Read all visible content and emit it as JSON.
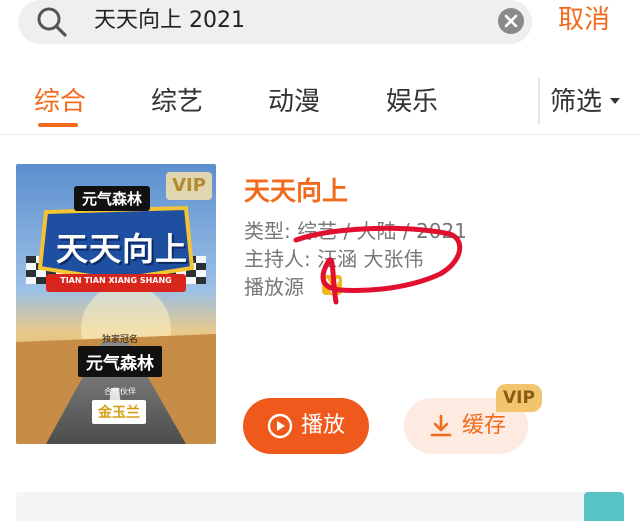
{
  "search": {
    "query": "天天向上 2021",
    "cancel_label": "取消"
  },
  "tabs": [
    {
      "label": "综合",
      "active": true
    },
    {
      "label": "综艺",
      "active": false
    },
    {
      "label": "动漫",
      "active": false
    },
    {
      "label": "娱乐",
      "active": false
    }
  ],
  "filter_label": "筛选",
  "result": {
    "poster": {
      "badge": "VIP",
      "brand_top": "元气森林",
      "title_art": "天天向上",
      "subtitle_art": "TIAN TIAN XIANG SHANG",
      "sponsor_caption": "独家冠名",
      "sponsor": "元气森林",
      "partner_caption": "合作伙伴",
      "partner": "金玉兰"
    },
    "title": "天天向上",
    "type_row": "类型: 综艺 / 大陆 / 2021",
    "host_row": "主持人: 汪涵 大张伟",
    "source_label": "播放源",
    "source_icon": "youku-v-icon",
    "play_label": "播放",
    "cache_label": "缓存",
    "cache_badge": "VIP"
  },
  "colors": {
    "accent": "#f26b1d",
    "play_bg": "#ef5a1c",
    "cache_bg": "#fdeae0",
    "vip_gold": "#f1c46d",
    "annotation_red": "#e0102e"
  }
}
